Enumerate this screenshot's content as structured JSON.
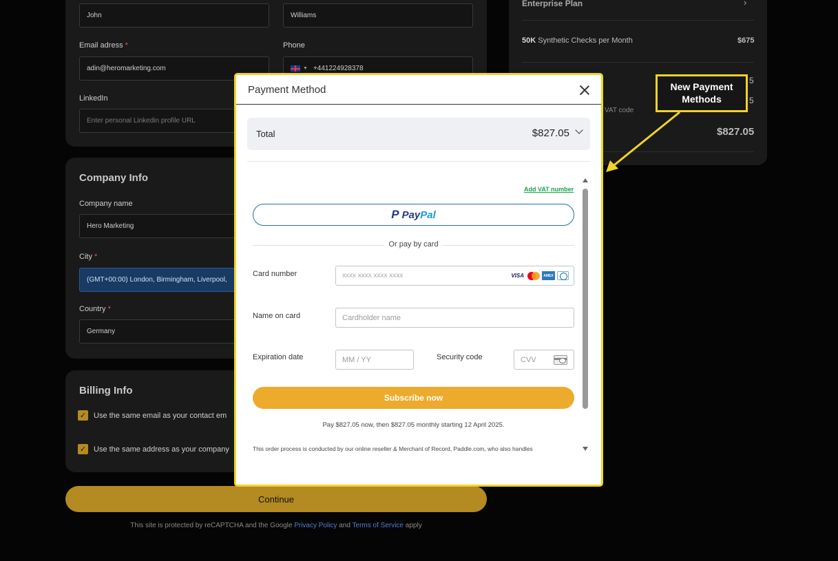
{
  "personal": {
    "first_name_value": "John",
    "last_name_value": "Williams",
    "email_label": "Email adress",
    "email_value": "adin@heromarketing.com",
    "phone_label": "Phone",
    "phone_value": "+441224928378",
    "linkedin_label": "LinkedIn",
    "linkedin_placeholder": "Enter personal Linkedin profile URL"
  },
  "company": {
    "title": "Company Info",
    "name_label": "Company name",
    "name_value": "Hero Marketing",
    "city_label": "City",
    "city_value": "(GMT+00:00) London, Birmingham, Liverpool,",
    "country_label": "Country",
    "country_value": "Germany"
  },
  "billing": {
    "title": "Billing Info",
    "same_email_label": "Use the same email as your contact em",
    "same_address_label": "Use the same address as your company"
  },
  "required_mark": "*",
  "continue_label": "Continue",
  "recaptcha": {
    "prefix": "This site is protected by reCAPTCHA and the Google",
    "privacy": "Privacy Policy",
    "and": "and",
    "terms": "Terms of Service",
    "suffix": "apply"
  },
  "summary": {
    "plan": "Enterprise Plan",
    "checks_bold": "50K",
    "checks_text": "Synthetic Checks per Month",
    "checks_price": "$675",
    "partial_1": "5",
    "partial_2": "5",
    "vat_partial": "VAT code",
    "total": "$827.05"
  },
  "modal": {
    "title": "Payment Method",
    "total_label": "Total",
    "total_amount": "$827.05",
    "add_vat": "Add VAT number",
    "paypal_pay": "Pay",
    "paypal_pal": "Pal",
    "or_text": "Or pay by card",
    "card_number_label": "Card number",
    "card_number_placeholder": "xxxx xxxx xxxx xxxx",
    "visa": "VISA",
    "amex": "AMEX",
    "name_label": "Name on card",
    "name_placeholder": "Cardholder name",
    "exp_label": "Expiration date",
    "exp_placeholder": "MM / YY",
    "sec_label": "Security code",
    "sec_placeholder": "CVV",
    "subscribe": "Subscribe now",
    "pay_note": "Pay $827.05 now, then $827.05 monthly starting 12 April 2025.",
    "legal_note": "This order process is conducted by our online reseller & Merchant of Record, Paddle.com, who also handles"
  },
  "callout": {
    "line1": "New Payment",
    "line2": "Methods"
  },
  "colors": {
    "accent": "#ecab2c",
    "callout_border": "#f2d32a",
    "link_green": "#16a34a"
  }
}
